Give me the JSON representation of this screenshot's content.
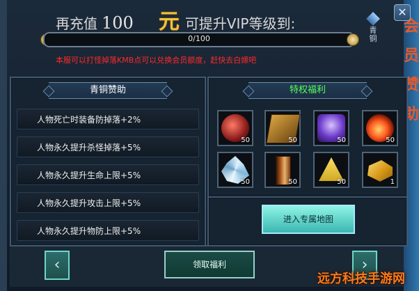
{
  "header": {
    "prefix": "再充值",
    "amount": "100",
    "currency": "元",
    "suffix": "可提升VIP等级到:",
    "vip_tier": "青\n铜",
    "progress_text": "0/100",
    "progress_fraction": 0,
    "notice": "本服可以打怪掉落KMB点可以兑换会员额度，赶快去白嫖吧"
  },
  "left_panel": {
    "title": "青铜赞助",
    "benefits": [
      "人物死亡时装备防掉落+2%",
      "人物永久提升杀怪掉落+5%",
      "人物永久提升生命上限+5%",
      "人物永久提升攻击上限+5%",
      "人物永久提升物防上限+5%"
    ]
  },
  "right_panel": {
    "title": "特权福利",
    "items": [
      {
        "icon": "red-orb-icon",
        "count": "50"
      },
      {
        "icon": "golden-chest-icon",
        "count": "50"
      },
      {
        "icon": "purple-crystal-ball-icon",
        "count": "50"
      },
      {
        "icon": "fire-phoenix-icon",
        "count": "50"
      },
      {
        "icon": "ice-crystal-icon",
        "count": "50"
      },
      {
        "icon": "book-icon",
        "count": "50"
      },
      {
        "icon": "golden-triangle-icon",
        "count": "50"
      },
      {
        "icon": "gold-bars-icon",
        "count": "1"
      }
    ],
    "map_button": "进入专属地图"
  },
  "bottom": {
    "claim_button": "领取福利",
    "prev_icon": "chevron-left-icon",
    "next_icon": "chevron-right-icon"
  },
  "window": {
    "close_icon": "close-icon",
    "side_art_chars": [
      "会",
      "员",
      "赞",
      "助"
    ]
  },
  "watermark": "远方科技手游网"
}
